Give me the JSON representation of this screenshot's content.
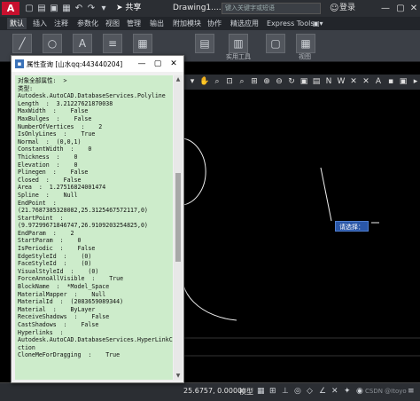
{
  "titlebar": {
    "logo": "A",
    "share_label": "共享",
    "doc_title": "Drawing1....",
    "search_placeholder": "键入关键字或短语",
    "login_label": "登录"
  },
  "ribbon_tabs": [
    "默认",
    "插入",
    "注释",
    "参数化",
    "视图",
    "管理",
    "输出",
    "附加模块",
    "协作",
    "精选应用",
    "Express Tools"
  ],
  "ribbon_labels": {
    "utility": "实用工具",
    "view": "视图"
  },
  "dialog": {
    "title": "属性查询 [山水qq:443440204]",
    "lines": [
      "对象全部属性:  >",
      "类型:",
      "Autodesk.AutoCAD.DatabaseServices.Polyline",
      "Length  :  3.21227621870038",
      "MaxWidth  :    False",
      "MaxBulges  :    False",
      "NumberOfVertices  :    2",
      "IsOnlyLines  :    True",
      "Normal  :  (0,0,1)",
      "ConstantWidth  :    0",
      "Thickness  :    0",
      "Elevation  :    0",
      "Plinegen  :    False",
      "Closed  :    False",
      "Area  :  1.27516824001474",
      "Spline  :    Null",
      "EndPoint  :",
      "(21.7687385328082,25.3125467572117,0)",
      "StartPoint  :",
      "(9.97299671846747,26.9109203254825,0)",
      "EndParam  :    2",
      "StartParam  :    0",
      "IsPeriodic  :    False",
      "EdgeStyleId  :    (0)",
      "FaceStyleId  :    (0)",
      "VisualStyleId  :    (0)",
      "ForceAnnoAllVisible  :    True",
      "BlockName  :  *Model_Space",
      "MaterialMapper  :    Null",
      "MaterialId  :  (2083659089344)",
      "Material  :    ByLayer",
      "ReceiveShadows  :    False",
      "CastShadows  :    False",
      "Hyperlinks  :",
      "Autodesk.AutoCAD.DatabaseServices.HyperLinkColle",
      "ction",
      "CloneMeForDragging  :    True"
    ]
  },
  "canvas": {
    "prompt_label": "请选择："
  },
  "statusbar": {
    "coords": "25.6757, 0.0000",
    "model_tab": "模型",
    "watermark": "CSDN @Itoyo"
  },
  "colors": {
    "dialog_content_bg": "#cdeccb",
    "prompt_bg": "#2a57a8",
    "logo_red": "#c8102e"
  }
}
